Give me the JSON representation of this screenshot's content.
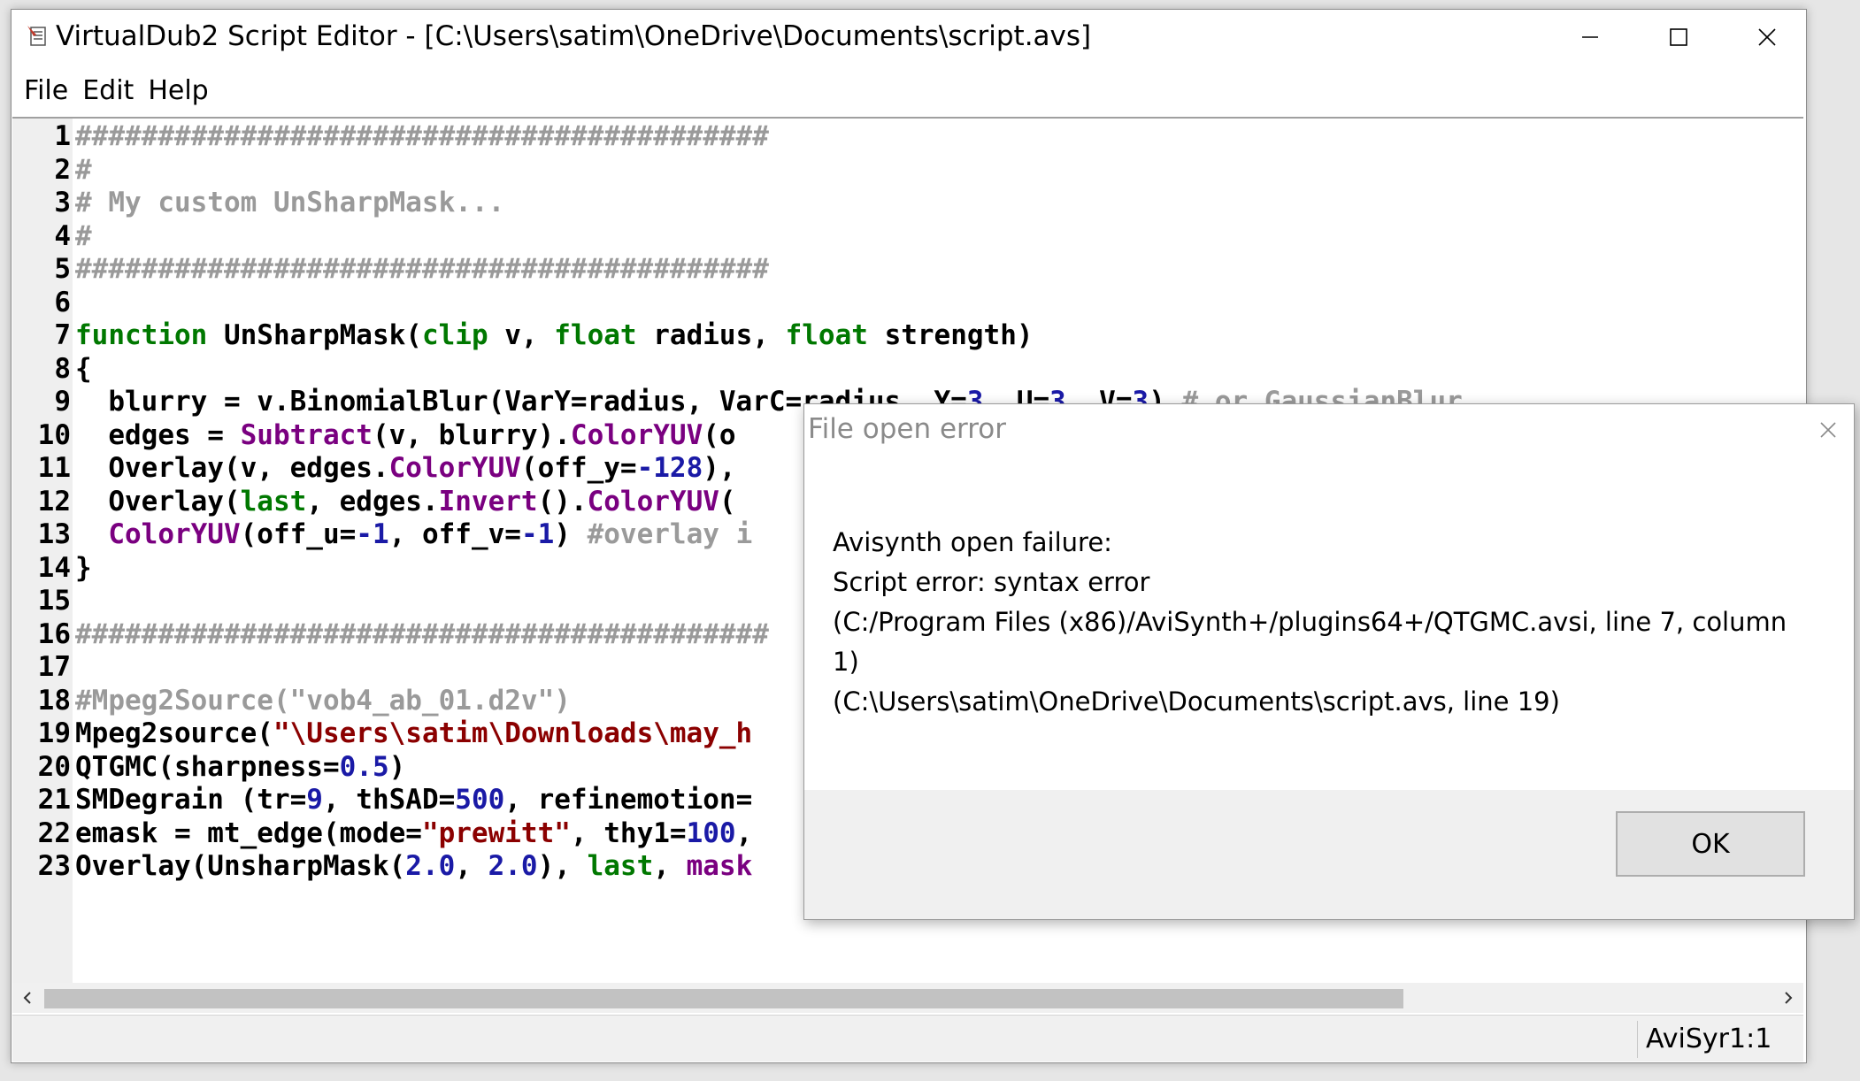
{
  "window": {
    "title": "VirtualDub2 Script Editor - [C:\\Users\\satim\\OneDrive\\Documents\\script.avs]",
    "app_icon": "script-editor-icon",
    "controls": [
      "minimize-icon",
      "maximize-icon",
      "close-icon"
    ]
  },
  "menu": {
    "items": [
      "File",
      "Edit",
      "Help"
    ]
  },
  "colors": {
    "keyword": "#007800",
    "function": "#7a0080",
    "comment": "#9a9a9a",
    "string": "#8b0000",
    "number": "#1a1aa6",
    "default": "#000000"
  },
  "editor": {
    "lines": [
      {
        "num": "1",
        "tokens": [
          {
            "t": "##########################################",
            "c": "comment"
          }
        ]
      },
      {
        "num": "2",
        "tokens": [
          {
            "t": "#",
            "c": "comment"
          }
        ]
      },
      {
        "num": "3",
        "tokens": [
          {
            "t": "# My custom UnSharpMask...",
            "c": "comment"
          }
        ]
      },
      {
        "num": "4",
        "tokens": [
          {
            "t": "#",
            "c": "comment"
          }
        ]
      },
      {
        "num": "5",
        "tokens": [
          {
            "t": "##########################################",
            "c": "comment"
          }
        ]
      },
      {
        "num": "6",
        "tokens": []
      },
      {
        "num": "7",
        "tokens": [
          {
            "t": "function",
            "c": "keyword"
          },
          {
            "t": " UnSharpMask(",
            "c": "default"
          },
          {
            "t": "clip",
            "c": "keyword"
          },
          {
            "t": " v, ",
            "c": "default"
          },
          {
            "t": "float",
            "c": "keyword"
          },
          {
            "t": " radius, ",
            "c": "default"
          },
          {
            "t": "float",
            "c": "keyword"
          },
          {
            "t": " strength)",
            "c": "default"
          }
        ]
      },
      {
        "num": "8",
        "tokens": [
          {
            "t": "{",
            "c": "default"
          }
        ]
      },
      {
        "num": "9",
        "tokens": [
          {
            "t": "  blurry = v.BinomialBlur(VarY=radius, VarC=radius, Y=",
            "c": "default"
          },
          {
            "t": "3",
            "c": "number"
          },
          {
            "t": ", U=",
            "c": "default"
          },
          {
            "t": "3",
            "c": "number"
          },
          {
            "t": ", V=",
            "c": "default"
          },
          {
            "t": "3",
            "c": "number"
          },
          {
            "t": ") ",
            "c": "default"
          },
          {
            "t": "# or GaussianBlur",
            "c": "comment"
          }
        ]
      },
      {
        "num": "10",
        "tokens": [
          {
            "t": "  edges = ",
            "c": "default"
          },
          {
            "t": "Subtract",
            "c": "function"
          },
          {
            "t": "(v, blurry).",
            "c": "default"
          },
          {
            "t": "ColorYUV",
            "c": "function"
          },
          {
            "t": "(o",
            "c": "default"
          }
        ]
      },
      {
        "num": "11",
        "tokens": [
          {
            "t": "  Overlay(v, edges.",
            "c": "default"
          },
          {
            "t": "ColorYUV",
            "c": "function"
          },
          {
            "t": "(off_y=",
            "c": "default"
          },
          {
            "t": "-128",
            "c": "number"
          },
          {
            "t": "),",
            "c": "default"
          }
        ]
      },
      {
        "num": "12",
        "tokens": [
          {
            "t": "  Overlay(",
            "c": "default"
          },
          {
            "t": "last",
            "c": "keyword"
          },
          {
            "t": ", edges.",
            "c": "default"
          },
          {
            "t": "Invert",
            "c": "function"
          },
          {
            "t": "().",
            "c": "default"
          },
          {
            "t": "ColorYUV",
            "c": "function"
          },
          {
            "t": "(",
            "c": "default"
          }
        ]
      },
      {
        "num": "13",
        "tokens": [
          {
            "t": "  ",
            "c": "default"
          },
          {
            "t": "ColorYUV",
            "c": "function"
          },
          {
            "t": "(off_u=",
            "c": "default"
          },
          {
            "t": "-1",
            "c": "number"
          },
          {
            "t": ", off_v=",
            "c": "default"
          },
          {
            "t": "-1",
            "c": "number"
          },
          {
            "t": ") ",
            "c": "default"
          },
          {
            "t": "#overlay i",
            "c": "comment"
          }
        ]
      },
      {
        "num": "14",
        "tokens": [
          {
            "t": "}",
            "c": "default"
          }
        ]
      },
      {
        "num": "15",
        "tokens": []
      },
      {
        "num": "16",
        "tokens": [
          {
            "t": "##########################################",
            "c": "comment"
          }
        ]
      },
      {
        "num": "17",
        "tokens": []
      },
      {
        "num": "18",
        "tokens": [
          {
            "t": "#Mpeg2Source(\"vob4_ab_01.d2v\")",
            "c": "comment"
          }
        ]
      },
      {
        "num": "19",
        "tokens": [
          {
            "t": "Mpeg2source(",
            "c": "default"
          },
          {
            "t": "\"\\Users\\satim\\Downloads\\may_h",
            "c": "string"
          }
        ]
      },
      {
        "num": "20",
        "tokens": [
          {
            "t": "QTGMC(sharpness=",
            "c": "default"
          },
          {
            "t": "0.5",
            "c": "number"
          },
          {
            "t": ")",
            "c": "default"
          }
        ]
      },
      {
        "num": "21",
        "tokens": [
          {
            "t": "SMDegrain (tr=",
            "c": "default"
          },
          {
            "t": "9",
            "c": "number"
          },
          {
            "t": ", thSAD=",
            "c": "default"
          },
          {
            "t": "500",
            "c": "number"
          },
          {
            "t": ", refinemotion=",
            "c": "default"
          }
        ]
      },
      {
        "num": "22",
        "tokens": [
          {
            "t": "emask = mt_edge(mode=",
            "c": "default"
          },
          {
            "t": "\"prewitt\"",
            "c": "string"
          },
          {
            "t": ", thy1=",
            "c": "default"
          },
          {
            "t": "100",
            "c": "number"
          },
          {
            "t": ",",
            "c": "default"
          }
        ]
      },
      {
        "num": "23",
        "tokens": [
          {
            "t": "Overlay(UnsharpMask(",
            "c": "default"
          },
          {
            "t": "2.0",
            "c": "number"
          },
          {
            "t": ", ",
            "c": "default"
          },
          {
            "t": "2.0",
            "c": "number"
          },
          {
            "t": "), ",
            "c": "default"
          },
          {
            "t": "last",
            "c": "keyword"
          },
          {
            "t": ", ",
            "c": "default"
          },
          {
            "t": "mask",
            "c": "function"
          }
        ]
      }
    ]
  },
  "scrollbar": {
    "left_icon": "chevron-left-icon",
    "right_icon": "chevron-right-icon"
  },
  "status": {
    "mode": "AviSyr",
    "position": "1:1"
  },
  "dialog": {
    "title": "File open error",
    "lines": [
      "Avisynth open failure:",
      "Script error: syntax error",
      "(C:/Program Files (x86)/AviSynth+/plugins64+/QTGMC.avsi, line 7, column",
      "1)",
      "(C:\\Users\\satim\\OneDrive\\Documents\\script.avs, line 19)"
    ],
    "ok_label": "OK"
  }
}
